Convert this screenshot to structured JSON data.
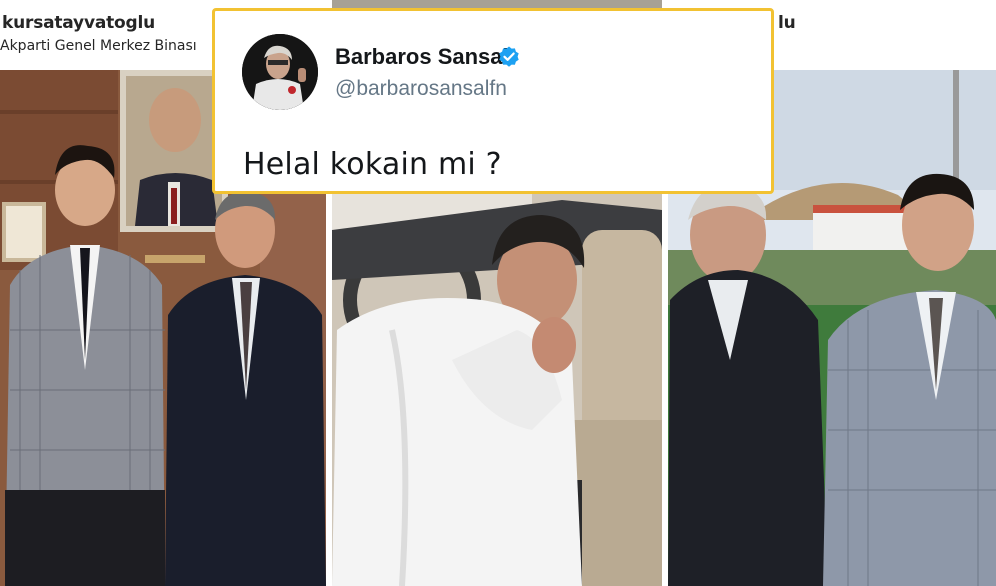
{
  "left_post": {
    "username": "kursatayvatoglu",
    "location": "Akparti Genel Merkez Binası"
  },
  "right_post": {
    "username_fragment": "lu"
  },
  "tweet": {
    "display_name": "Barbaros Sansal",
    "handle": "@barbarosansalfn",
    "text": "Helal kokain mi ?",
    "verified": true
  },
  "colors": {
    "highlight_border": "#f2c232",
    "verified_blue": "#1da1f2",
    "handle_gray": "#657786"
  }
}
